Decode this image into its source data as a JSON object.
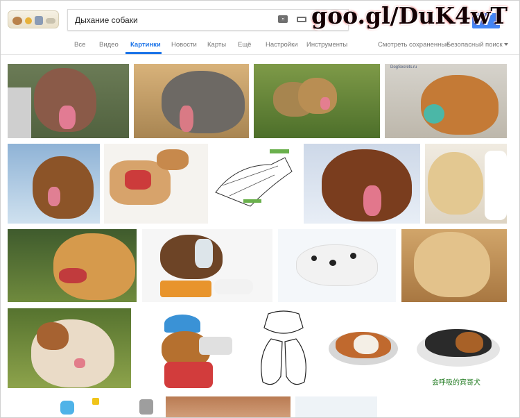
{
  "search": {
    "query": "Дыхание собаки"
  },
  "watermark": "goo.gl/DuK4wT",
  "tabs": [
    {
      "label": "Все",
      "active": false
    },
    {
      "label": "Видео",
      "active": false
    },
    {
      "label": "Картинки",
      "active": true
    },
    {
      "label": "Новости",
      "active": false
    },
    {
      "label": "Карты",
      "active": false
    },
    {
      "label": "Ещё",
      "active": false
    },
    {
      "label": "Настройки",
      "active": false
    },
    {
      "label": "Инструменты",
      "active": false
    }
  ],
  "right_links": {
    "saved": "Смотреть сохраненные",
    "safe_search": "Безопасный поиск"
  },
  "images": {
    "dogsecrets_caption": "DogSecrets.ru",
    "chinese_caption": "会呼吸的宾哥犬"
  },
  "colors": {
    "accent": "#1a73e8",
    "search_button": "#4285f4"
  }
}
